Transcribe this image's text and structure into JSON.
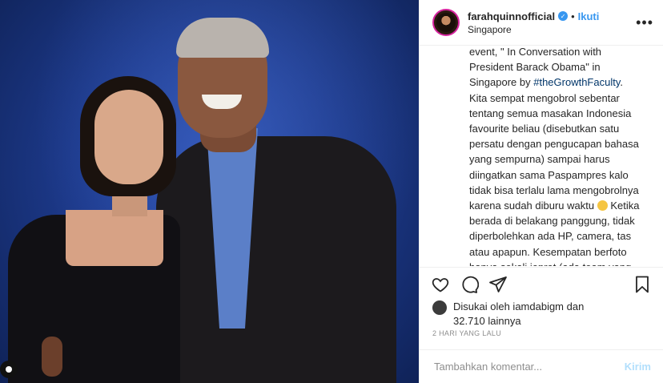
{
  "header": {
    "username": "farahquinnofficial",
    "verified_icon": "verified-badge-icon",
    "separator": "•",
    "follow_label": "Ikuti",
    "location": "Singapore",
    "more_icon": "more-options-icon"
  },
  "caption": {
    "text_before_hashtag": "event, \" In Conversation with President Barack Obama\" in Singapore by ",
    "hashtag": "#theGrowthFaculty",
    "text_after_hashtag": ". Kita sempat mengobrol sebentar tentang semua masakan Indonesia favourite beliau (disebutkan satu persatu dengan pengucapan bahasa yang sempurna) sampai harus diingatkan sama Paspampres kalo tidak bisa terlalu lama mengobrolnya karena sudah diburu waktu ",
    "emoji_icon": "grinning-sweat-emoji",
    "text_after_emoji": " Ketika berada di belakang panggung, tidak diperbolehkan ada HP, camera, tas atau apapun. Kesempatan berfoto hanya sekali jepret (ada team yang sudah disiapkan), langsung berdo'a"
  },
  "actions": {
    "like_icon": "heart-icon",
    "comment_icon": "comment-icon",
    "share_icon": "share-icon",
    "save_icon": "bookmark-icon"
  },
  "likes": {
    "line1": "Disukai oleh iamdabigm dan",
    "line2": "32.710 lainnya"
  },
  "timestamp": "2 HARI YANG LALU",
  "comment": {
    "placeholder": "Tambahkan komentar...",
    "post_label": "Kirim"
  },
  "colors": {
    "accent": "#3897f0",
    "hashtag": "#003569",
    "muted": "#8e8e8e",
    "post_disabled": "#b2dffc"
  }
}
